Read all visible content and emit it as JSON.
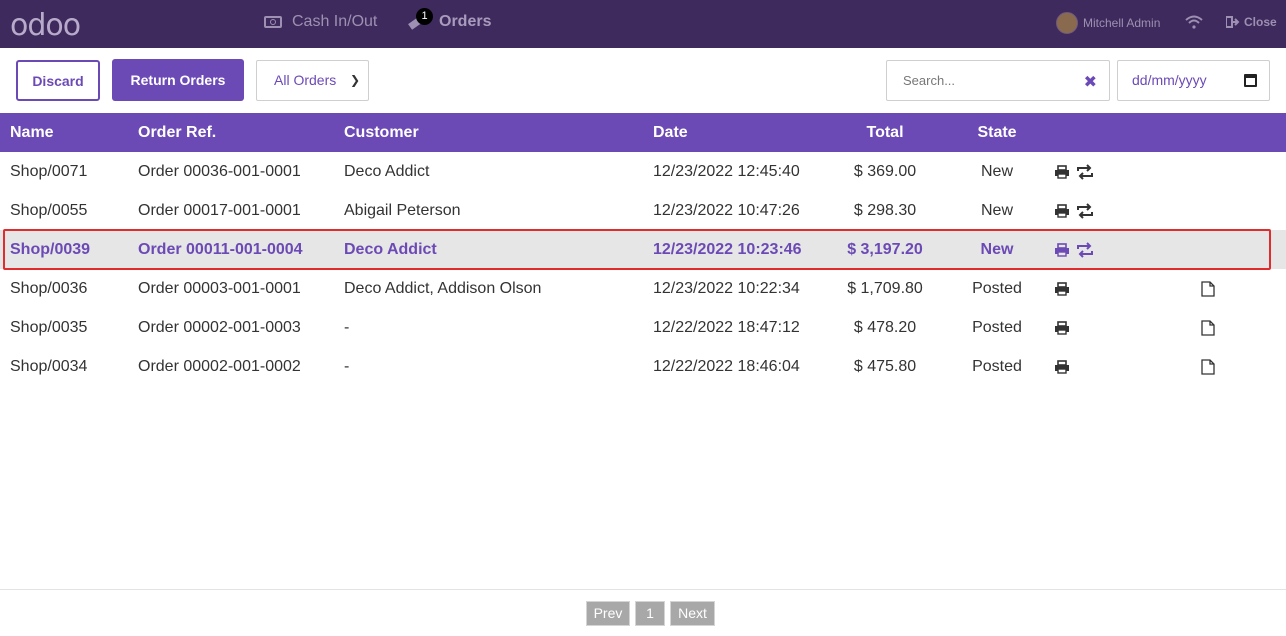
{
  "app": {
    "logo": "odoo"
  },
  "nav": {
    "cash_label": "Cash In/Out",
    "orders_label": "Orders",
    "orders_badge": "1"
  },
  "user": {
    "name": "Mitchell Admin",
    "close_label": "Close"
  },
  "toolbar": {
    "discard_label": "Discard",
    "return_label": "Return Orders",
    "filter_value": "All Orders",
    "search_placeholder": "Search...",
    "date_placeholder": "dd/mm/yyyy"
  },
  "table": {
    "headers": {
      "name": "Name",
      "ref": "Order Ref.",
      "customer": "Customer",
      "date": "Date",
      "total": "Total",
      "state": "State"
    },
    "rows": [
      {
        "name": "Shop/0071",
        "ref": "Order 00036-001-0001",
        "customer": "Deco Addict",
        "date": "12/23/2022 12:45:40",
        "total": "$ 369.00",
        "state": "New"
      },
      {
        "name": "Shop/0055",
        "ref": "Order 00017-001-0001",
        "customer": "Abigail Peterson",
        "date": "12/23/2022 10:47:26",
        "total": "$ 298.30",
        "state": "New"
      },
      {
        "name": "Shop/0039",
        "ref": "Order 00011-001-0004",
        "customer": "Deco Addict",
        "date": "12/23/2022 10:23:46",
        "total": "$ 3,197.20",
        "state": "New"
      },
      {
        "name": "Shop/0036",
        "ref": "Order 00003-001-0001",
        "customer": "Deco Addict, Addison Olson",
        "date": "12/23/2022 10:22:34",
        "total": "$ 1,709.80",
        "state": "Posted"
      },
      {
        "name": "Shop/0035",
        "ref": "Order 00002-001-0003",
        "customer": "-",
        "date": "12/22/2022 18:47:12",
        "total": "$ 478.20",
        "state": "Posted"
      },
      {
        "name": "Shop/0034",
        "ref": "Order 00002-001-0002",
        "customer": "-",
        "date": "12/22/2022 18:46:04",
        "total": "$ 475.80",
        "state": "Posted"
      }
    ]
  },
  "pagination": {
    "prev": "Prev",
    "page": "1",
    "next": "Next"
  },
  "colors": {
    "brand": "#6c4ab6",
    "topbar": "#3e2a5c",
    "selected_border": "#e02c2c"
  },
  "icons": [
    "cash-icon",
    "orders-icon",
    "wifi-icon",
    "logout-icon",
    "clear-search-icon",
    "calendar-icon",
    "printer-icon",
    "refund-icon",
    "invoice-icon"
  ]
}
